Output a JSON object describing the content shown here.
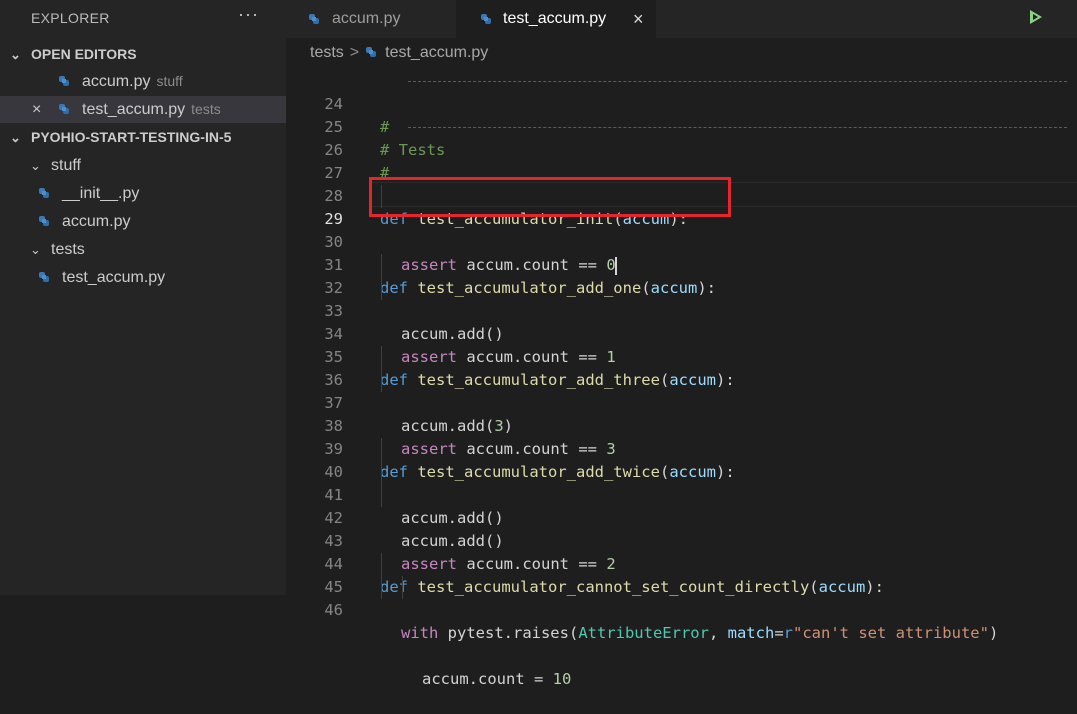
{
  "sidebar": {
    "title": "EXPLORER",
    "more": "···",
    "open_editors_label": "OPEN EDITORS",
    "open_editors": [
      {
        "name": "accum.py",
        "desc": "stuff"
      },
      {
        "name": "test_accum.py",
        "desc": "tests"
      }
    ],
    "close_glyph": "×",
    "project_label": "PYOHIO-START-TESTING-IN-5",
    "folders": [
      {
        "name": "stuff",
        "files": [
          "__init__.py",
          "accum.py"
        ]
      },
      {
        "name": "tests",
        "files": [
          "test_accum.py"
        ]
      }
    ]
  },
  "tabs": [
    {
      "label": "accum.py",
      "active": false
    },
    {
      "label": "test_accum.py",
      "active": true,
      "close": "×"
    }
  ],
  "breadcrumb": {
    "folder": "tests",
    "sep": ">",
    "file": "test_accum.py"
  },
  "editor": {
    "current_line": 29,
    "lines": [
      {
        "n": "24",
        "code": "# "
      },
      {
        "n": "25",
        "code": "# Tests"
      },
      {
        "n": "26",
        "code": "# "
      },
      {
        "n": "27",
        "code": ""
      },
      {
        "n": "28",
        "code": "def test_accumulator_init(accum):"
      },
      {
        "n": "29",
        "code": "assert accum.count == 0"
      },
      {
        "n": "30",
        "code": ""
      },
      {
        "n": "31",
        "code": "def test_accumulator_add_one(accum):"
      },
      {
        "n": "32",
        "code": "accum.add()"
      },
      {
        "n": "33",
        "code": "assert accum.count == 1"
      },
      {
        "n": "34",
        "code": ""
      },
      {
        "n": "35",
        "code": "def test_accumulator_add_three(accum):"
      },
      {
        "n": "36",
        "code": "accum.add(3)"
      },
      {
        "n": "37",
        "code": "assert accum.count == 3"
      },
      {
        "n": "38",
        "code": ""
      },
      {
        "n": "39",
        "code": "def test_accumulator_add_twice(accum):"
      },
      {
        "n": "40",
        "code": "accum.add()"
      },
      {
        "n": "41",
        "code": "accum.add()"
      },
      {
        "n": "42",
        "code": "assert accum.count == 2"
      },
      {
        "n": "43",
        "code": ""
      },
      {
        "n": "44",
        "code": "def test_accumulator_cannot_set_count_directly(accum):"
      },
      {
        "n": "45",
        "code": "with pytest.raises(AttributeError, match=r\"can't set attribute\")"
      },
      {
        "n": "46",
        "code": "accum.count = 10"
      }
    ]
  },
  "colors": {
    "keyword": "#569cd6",
    "control": "#c586c0",
    "function": "#dcdcaa",
    "param": "#9cdcfe",
    "comment": "#6a9955",
    "highlight_box": "#e4252d",
    "run_icon": "#89d185"
  },
  "icons": {
    "python_file": "python-icon",
    "run": "play-icon",
    "chevron": "chevron-down-icon"
  }
}
